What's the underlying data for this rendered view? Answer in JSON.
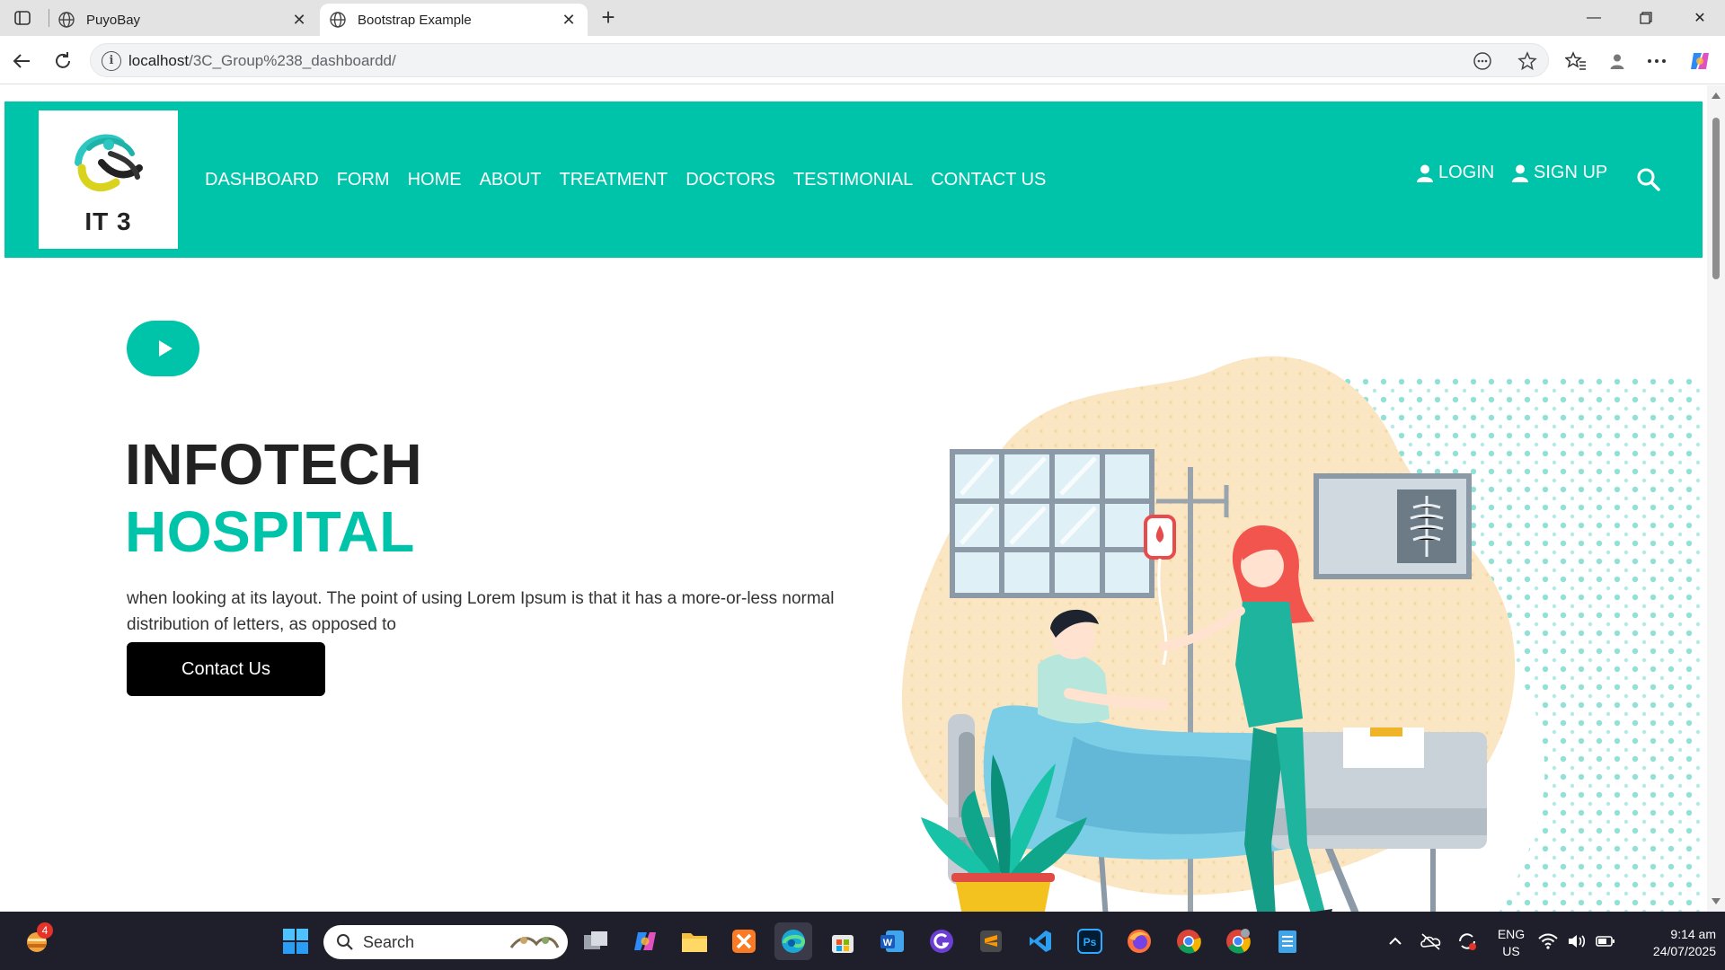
{
  "browser": {
    "tabs": [
      {
        "title": "PuyoBay",
        "active": false
      },
      {
        "title": "Bootstrap Example",
        "active": true
      }
    ],
    "url_host": "localhost",
    "url_path": "/3C_Group%238_dashboardd/"
  },
  "site": {
    "logo_text": "IT 3",
    "nav": [
      "DASHBOARD",
      "FORM",
      "HOME",
      "ABOUT",
      "TREATMENT",
      "DOCTORS",
      "TESTIMONIAL",
      "CONTACT US"
    ],
    "login_label": "LOGIN",
    "signup_label": "SIGN UP",
    "accent_color": "#00c4aa"
  },
  "hero": {
    "title_line1": "INFOTECH",
    "title_line2": "HOSPITAL",
    "text": "when looking at its layout. The point of using Lorem Ipsum is that it has a more-or-less normal distribution of letters, as opposed to",
    "button_label": "Contact Us"
  },
  "taskbar": {
    "search_label": "Search",
    "notification_count": "4",
    "lang_line1": "ENG",
    "lang_line2": "US",
    "time": "9:14 am",
    "date": "24/07/2025"
  }
}
